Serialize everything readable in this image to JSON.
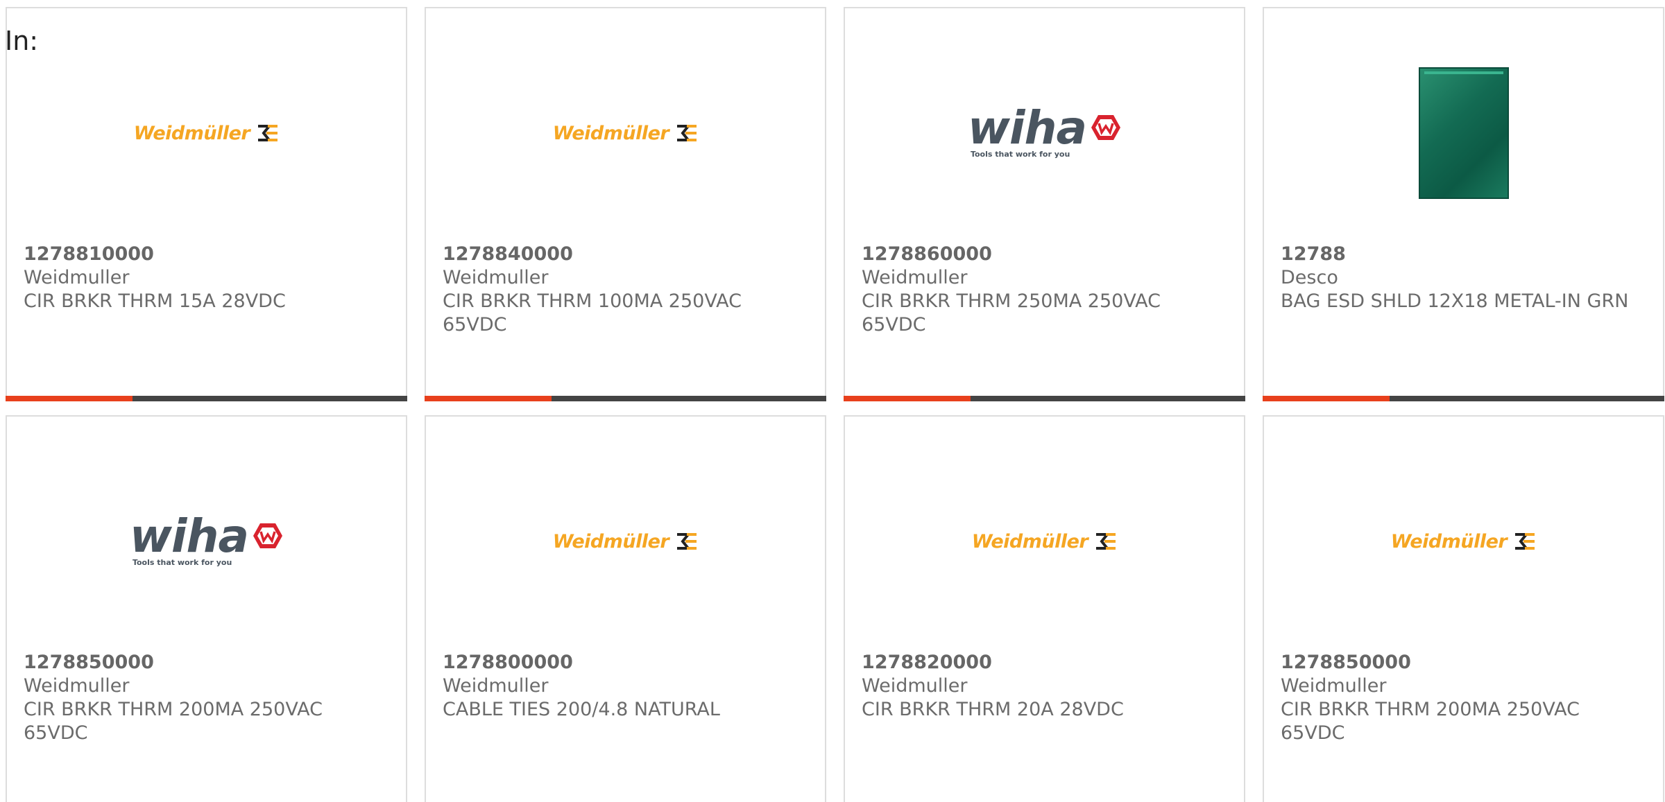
{
  "page": {
    "filter_label": "In:"
  },
  "colors": {
    "accent": "#e8401c",
    "bar": "#444444",
    "weidmuller_orange": "#f5a623",
    "wiha_gray": "#4a5560",
    "wiha_red": "#d9232e"
  },
  "products": [
    {
      "part_number": "1278810000",
      "manufacturer": "Weidmuller",
      "description": "CIR BRKR THRM 15A 28VDC",
      "logo": "weidmuller"
    },
    {
      "part_number": "1278840000",
      "manufacturer": "Weidmuller",
      "description": "CIR BRKR THRM 100MA 250VAC 65VDC",
      "logo": "weidmuller"
    },
    {
      "part_number": "1278860000",
      "manufacturer": "Weidmuller",
      "description": "CIR BRKR THRM 250MA 250VAC 65VDC",
      "logo": "wiha"
    },
    {
      "part_number": "12788",
      "manufacturer": "Desco",
      "description": "BAG ESD SHLD 12X18 METAL-IN GRN",
      "logo": "bag-photo"
    },
    {
      "part_number": "1278850000",
      "manufacturer": "Weidmuller",
      "description": "CIR BRKR THRM 200MA 250VAC 65VDC",
      "logo": "wiha"
    },
    {
      "part_number": "1278800000",
      "manufacturer": "Weidmuller",
      "description": "CABLE TIES 200/4.8 NATURAL",
      "logo": "weidmuller"
    },
    {
      "part_number": "1278820000",
      "manufacturer": "Weidmuller",
      "description": "CIR BRKR THRM 20A 28VDC",
      "logo": "weidmuller"
    },
    {
      "part_number": "1278850000",
      "manufacturer": "Weidmuller",
      "description": "CIR BRKR THRM 200MA 250VAC 65VDC",
      "logo": "weidmuller"
    }
  ],
  "logos": {
    "weidmuller": {
      "text": "Weidmüller"
    },
    "wiha": {
      "text": "wiha",
      "tagline": "Tools that work for you"
    }
  }
}
